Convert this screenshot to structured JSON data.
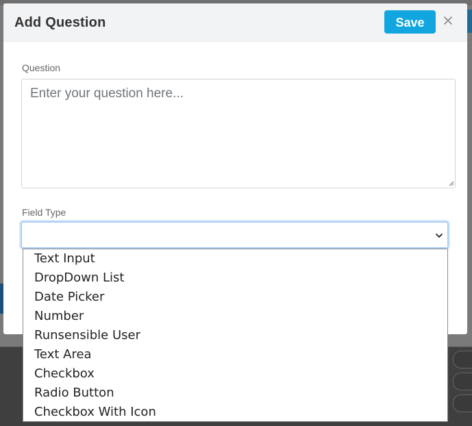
{
  "modal": {
    "title": "Add Question",
    "save_label": "Save",
    "close_icon": "close-icon"
  },
  "form": {
    "question_label": "Question",
    "question_placeholder": "Enter your question here...",
    "question_value": "",
    "field_type_label": "Field Type",
    "field_type_value": ""
  },
  "dropdown": {
    "options": [
      "Text Input",
      "DropDown List",
      "Date Picker",
      "Number",
      "Runsensible User",
      "Text Area",
      "Checkbox",
      "Radio Button",
      "Checkbox With Icon"
    ]
  },
  "colors": {
    "accent": "#11a6e0",
    "header_bg": "#f2f3f5",
    "select_focus": "#a9cdf4"
  }
}
